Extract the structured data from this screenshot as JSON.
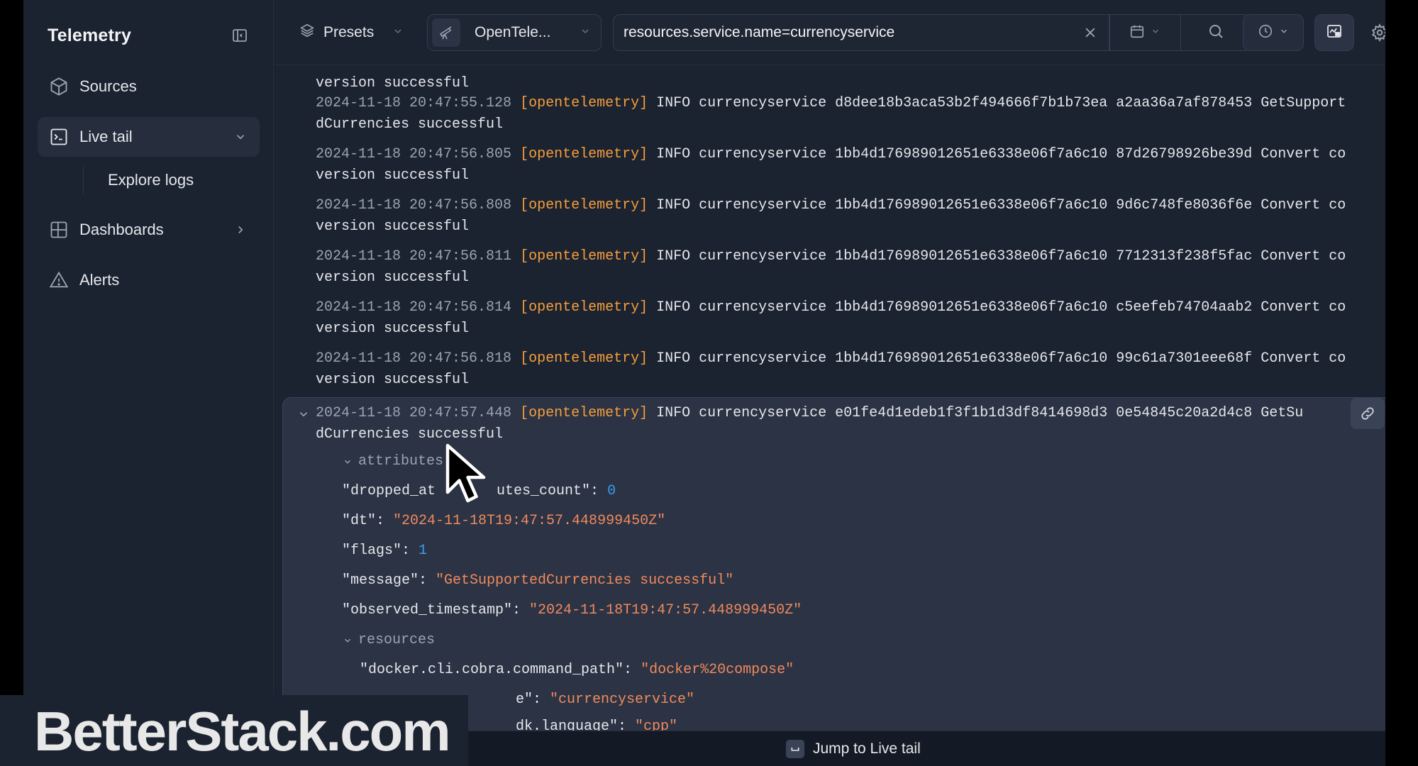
{
  "sidebar": {
    "title": "Telemetry",
    "items": [
      {
        "label": "Sources",
        "icon": "cube-icon"
      },
      {
        "label": "Live tail",
        "icon": "terminal-icon",
        "active": true,
        "expanded": true
      },
      {
        "label": "Dashboards",
        "icon": "dashboard-grid-icon"
      },
      {
        "label": "Alerts",
        "icon": "warning-triangle-icon"
      }
    ],
    "sub_item": "Explore logs"
  },
  "topbar": {
    "presets_label": "Presets",
    "source_label": "OpenTele...",
    "query_value": "resources.service.name=currencyservice"
  },
  "logs": [
    {
      "l1": "",
      "l2": "version successful"
    },
    {
      "ts": "2024-11-18 20:47:55.128",
      "source": "[opentelemetry]",
      "msg": "INFO currencyservice d8dee18b3aca53b2f494666f7b1b73ea a2aa36a7af878453 GetSupport",
      "l2": "dCurrencies successful"
    },
    {
      "ts": "2024-11-18 20:47:56.805",
      "source": "[opentelemetry]",
      "msg": "INFO currencyservice 1bb4d176989012651e6338e06f7a6c10 87d26798926be39d Convert co",
      "l2": "version successful"
    },
    {
      "ts": "2024-11-18 20:47:56.808",
      "source": "[opentelemetry]",
      "msg": "INFO currencyservice 1bb4d176989012651e6338e06f7a6c10 9d6c748fe8036f6e Convert co",
      "l2": "version successful"
    },
    {
      "ts": "2024-11-18 20:47:56.811",
      "source": "[opentelemetry]",
      "msg": "INFO currencyservice 1bb4d176989012651e6338e06f7a6c10 7712313f238f5fac Convert co",
      "l2": "version successful"
    },
    {
      "ts": "2024-11-18 20:47:56.814",
      "source": "[opentelemetry]",
      "msg": "INFO currencyservice 1bb4d176989012651e6338e06f7a6c10 c5eefeb74704aab2 Convert co",
      "l2": "version successful"
    },
    {
      "ts": "2024-11-18 20:47:56.818",
      "source": "[opentelemetry]",
      "msg": "INFO currencyservice 1bb4d176989012651e6338e06f7a6c10 99c61a7301eee68f Convert co",
      "l2": "version successful"
    }
  ],
  "expanded_log": {
    "ts": "2024-11-18 20:47:57.448",
    "source": "[opentelemetry]",
    "msg": "INFO currencyservice e01fe4d1edeb1f3f1b1d3df8414698d3 0e54845c20a2d4c8 GetSu",
    "l2": "dCurrencies successful",
    "attributes_label": "attributes",
    "attributes": [
      {
        "key": "\"dropped_at",
        "key_tail": "utes_count\": ",
        "value": "0",
        "type": "num"
      },
      {
        "key": "\"dt\": ",
        "value": "\"2024-11-18T19:47:57.448999450Z\"",
        "type": "str"
      },
      {
        "key": "\"flags\": ",
        "value": "1",
        "type": "num"
      },
      {
        "key": "\"message\": ",
        "value": "\"GetSupportedCurrencies successful\"",
        "type": "str"
      },
      {
        "key": "\"observed_timestamp\": ",
        "value": "\"2024-11-18T19:47:57.448999450Z\"",
        "type": "str"
      }
    ],
    "resources_label": "resources",
    "resources": [
      {
        "key": "\"docker.cli.cobra.command_path\": ",
        "value": "\"docker%20compose\"",
        "type": "str"
      },
      {
        "key": "e\": ",
        "value": "\"currencyservice\"",
        "type": "str"
      },
      {
        "key": "dk.language\": ",
        "value": "\"cpp\"",
        "type": "str"
      }
    ]
  },
  "footer": {
    "jump_label": "Jump to Live tail"
  },
  "watermark": "BetterStack.com",
  "colors": {
    "bg": "#1b2230",
    "source": "#f59e3b",
    "string": "#f08a5d",
    "number": "#3b9cf0"
  }
}
